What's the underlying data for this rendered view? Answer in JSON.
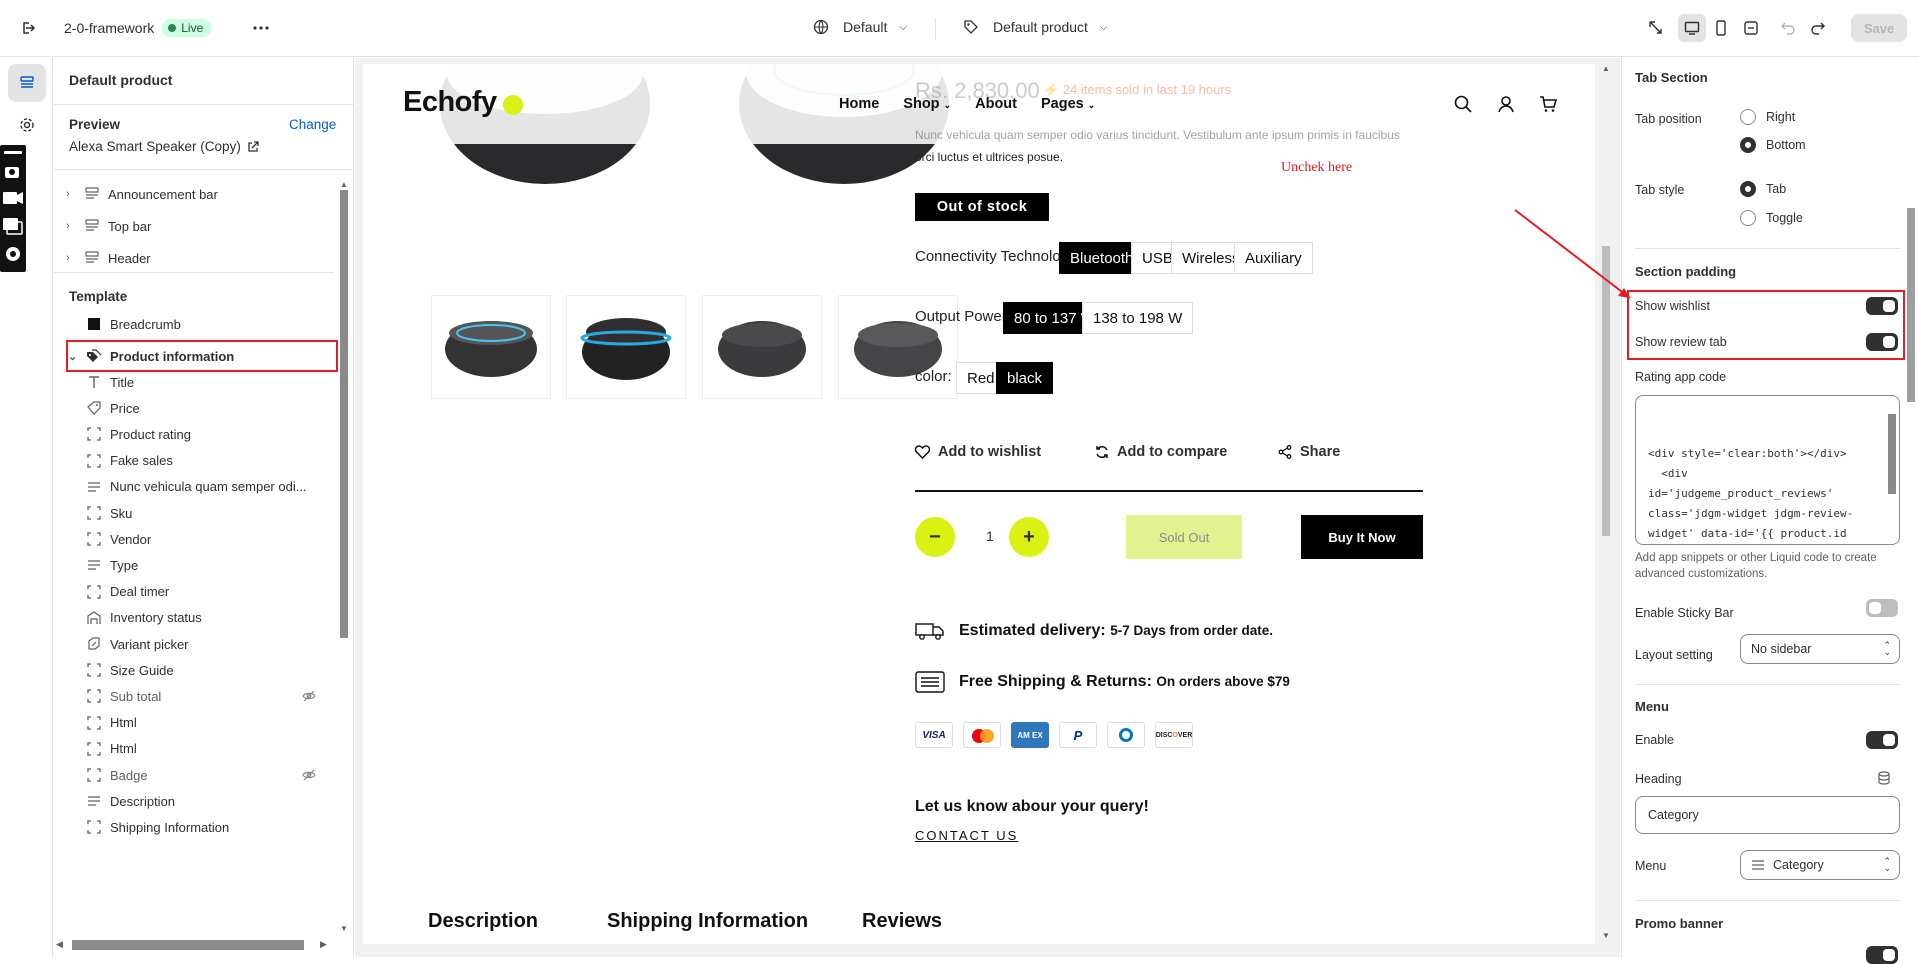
{
  "topbar": {
    "store_name": "2-0-framework",
    "live_badge": "Live",
    "theme_select": "Default",
    "template_select": "Default product",
    "save_label": "Save"
  },
  "sidebar": {
    "title": "Default product",
    "preview_label": "Preview",
    "change_label": "Change",
    "preview_product": "Alexa Smart Speaker (Copy)",
    "header_items": [
      "Announcement bar",
      "Top bar",
      "Header"
    ],
    "template_heading": "Template",
    "breadcrumb": "Breadcrumb",
    "product_information": "Product information",
    "blocks": [
      "Title",
      "Price",
      "Product rating",
      "Fake sales",
      "Nunc vehicula quam semper odi...",
      "Sku",
      "Vendor",
      "Type",
      "Deal timer",
      "Inventory status",
      "Variant picker",
      "Size Guide",
      "Sub total",
      "Html",
      "Html",
      "Badge",
      "Description",
      "Shipping Information"
    ]
  },
  "preview": {
    "logo": "Echofy",
    "nav": [
      "Home",
      "Shop",
      "About",
      "Pages"
    ],
    "price": "Rs. 2,830.00",
    "sold_text": "24 items sold in last 19 hours",
    "desc_line1": "Nunc vehicula quam semper odio varius tincidunt. Vestibulum ante ipsum primis in faucibus",
    "desc_line2": "orci luctus et ultrices posue.",
    "annotation": "Unchek here",
    "stock_badge": "Out of stock",
    "connectivity_label": "Connectivity Technology:",
    "connectivity_options": [
      "Bluetooth",
      "USB",
      "Wireless",
      "Auxiliary"
    ],
    "power_label": "Output Power:",
    "power_options": [
      "80 to 137 W",
      "138 to 198 W"
    ],
    "color_label": "color:",
    "color_options": [
      "Red",
      "black"
    ],
    "wishlist": "Add to wishlist",
    "compare": "Add to compare",
    "share": "Share",
    "qty": "1",
    "sold_out": "Sold Out",
    "buy_now": "Buy It Now",
    "delivery_bold": "Estimated delivery:",
    "delivery_rest": "5-7 Days from order date.",
    "shipping_bold": "Free Shipping & Returns:",
    "shipping_rest": "On orders above $79",
    "payment_cards": [
      "VISA",
      "MC",
      "AMEX",
      "PayPal",
      "Diners",
      "DISCOVER"
    ],
    "query": "Let us know abour your query!",
    "contact": "CONTACT US",
    "tabs": [
      "Description",
      "Shipping Information",
      "Reviews"
    ]
  },
  "settings": {
    "tab_section": "Tab Section",
    "tab_position_label": "Tab position",
    "tab_position_right": "Right",
    "tab_position_bottom": "Bottom",
    "tab_style_label": "Tab style",
    "tab_style_tab": "Tab",
    "tab_style_toggle": "Toggle",
    "section_padding": "Section padding",
    "show_wishlist": "Show wishlist",
    "show_review_tab": "Show review tab",
    "rating_app_code": "Rating app code",
    "code_lines": [
      "<div style='clear:both'></div>",
      "  <div",
      "id='judgeme_product_reviews'",
      "class='jdgm-widget jdgm-review-",
      "widget' data-id='{{ product.id",
      "}}'>",
      "    {{"
    ],
    "code_help": "Add app snippets or other Liquid code to create advanced customizations.",
    "sticky_bar": "Enable Sticky Bar",
    "layout_setting": "Layout setting",
    "layout_value": "No sidebar",
    "menu_title": "Menu",
    "enable": "Enable",
    "heading": "Heading",
    "heading_value": "Category",
    "menu_label": "Menu",
    "menu_value": "Category",
    "promo_banner": "Promo banner"
  },
  "colors": {
    "accent_lime": "#d9f214",
    "highlight_red": "#e51c23",
    "shopify_blue": "#005bd3"
  }
}
